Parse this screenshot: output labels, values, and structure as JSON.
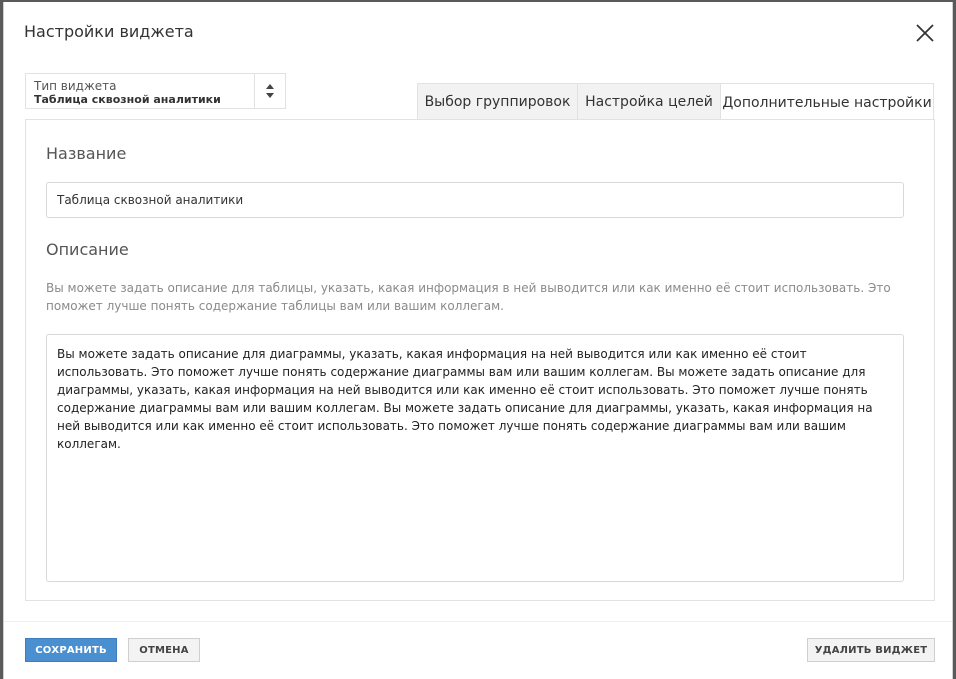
{
  "dialog": {
    "title": "Настройки виджета"
  },
  "widget_type": {
    "label": "Тип виджета",
    "value": "Таблица сквозной аналитики"
  },
  "tabs": [
    {
      "label": "Выбор группировок",
      "active": false
    },
    {
      "label": "Настройка целей",
      "active": false
    },
    {
      "label": "Дополнительные настройки",
      "active": true
    }
  ],
  "panel": {
    "name_title": "Название",
    "name_value": "Таблица сквозной аналитики",
    "description_title": "Описание",
    "description_hint": "Вы можете задать описание для таблицы, указать, какая информация в ней выводится или как именно её стоит использовать. Это поможет лучше понять содержание таблицы вам или вашим коллегам.",
    "description_value": "Вы можете задать описание для диаграммы, указать, какая информация на ней выводится или как именно её стоит использовать. Это поможет лучше понять содержание диаграммы вам или вашим коллегам. Вы можете задать описание для диаграммы, указать, какая информация на ней выводится или как именно её стоит использовать. Это поможет лучше понять содержание диаграммы вам или вашим коллегам. Вы можете задать описание для диаграммы, указать, какая информация на ней выводится или как именно её стоит использовать. Это поможет лучше понять содержание диаграммы вам или вашим коллегам."
  },
  "footer": {
    "save_label": "СОХРАНИТЬ",
    "cancel_label": "ОТМЕНА",
    "delete_label": "УДАЛИТЬ ВИДЖЕТ"
  },
  "colors": {
    "primary": "#4a90d0",
    "border": "#e2e2e2"
  },
  "icons": {
    "close": "close-icon",
    "select_arrows": "sort-arrows-icon"
  }
}
